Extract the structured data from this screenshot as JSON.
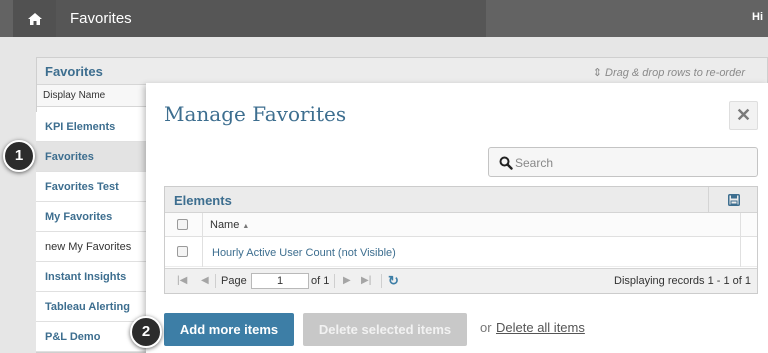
{
  "topbar": {
    "home_icon": "home-icon",
    "breadcrumb": "Favorites",
    "right_text": "Hi"
  },
  "background_panel": {
    "title": "Favorites",
    "drag_hint": "Drag & drop rows to re-order",
    "column_header": "Display Name",
    "items": [
      {
        "label": "KPI Elements"
      },
      {
        "label": "Favorites"
      },
      {
        "label": "Favorites Test"
      },
      {
        "label": "My Favorites"
      },
      {
        "label": "new My Favorites"
      },
      {
        "label": "Instant Insights"
      },
      {
        "label": "Tableau Alerting"
      },
      {
        "label": "P&L Demo"
      }
    ]
  },
  "modal": {
    "title": "Manage Favorites",
    "close_glyph": "✕",
    "search": {
      "placeholder": "Search"
    },
    "grid": {
      "title": "Elements",
      "column_name": "Name",
      "rows": [
        {
          "name": "Hourly Active User Count (not Visible)"
        }
      ],
      "pager": {
        "page_label": "Page",
        "page_value": "1",
        "of_label": "of 1",
        "displaying": "Displaying records 1 - 1 of 1"
      }
    },
    "buttons": {
      "add": "Add more items",
      "delete_selected": "Delete selected items",
      "or": "or",
      "delete_all": "Delete all items"
    }
  },
  "callouts": [
    "1",
    "2"
  ],
  "colors": {
    "accent": "#3d7ea6",
    "link": "#3d6e8f",
    "topbar": "#636363",
    "disabled": "#c8c8c8"
  }
}
